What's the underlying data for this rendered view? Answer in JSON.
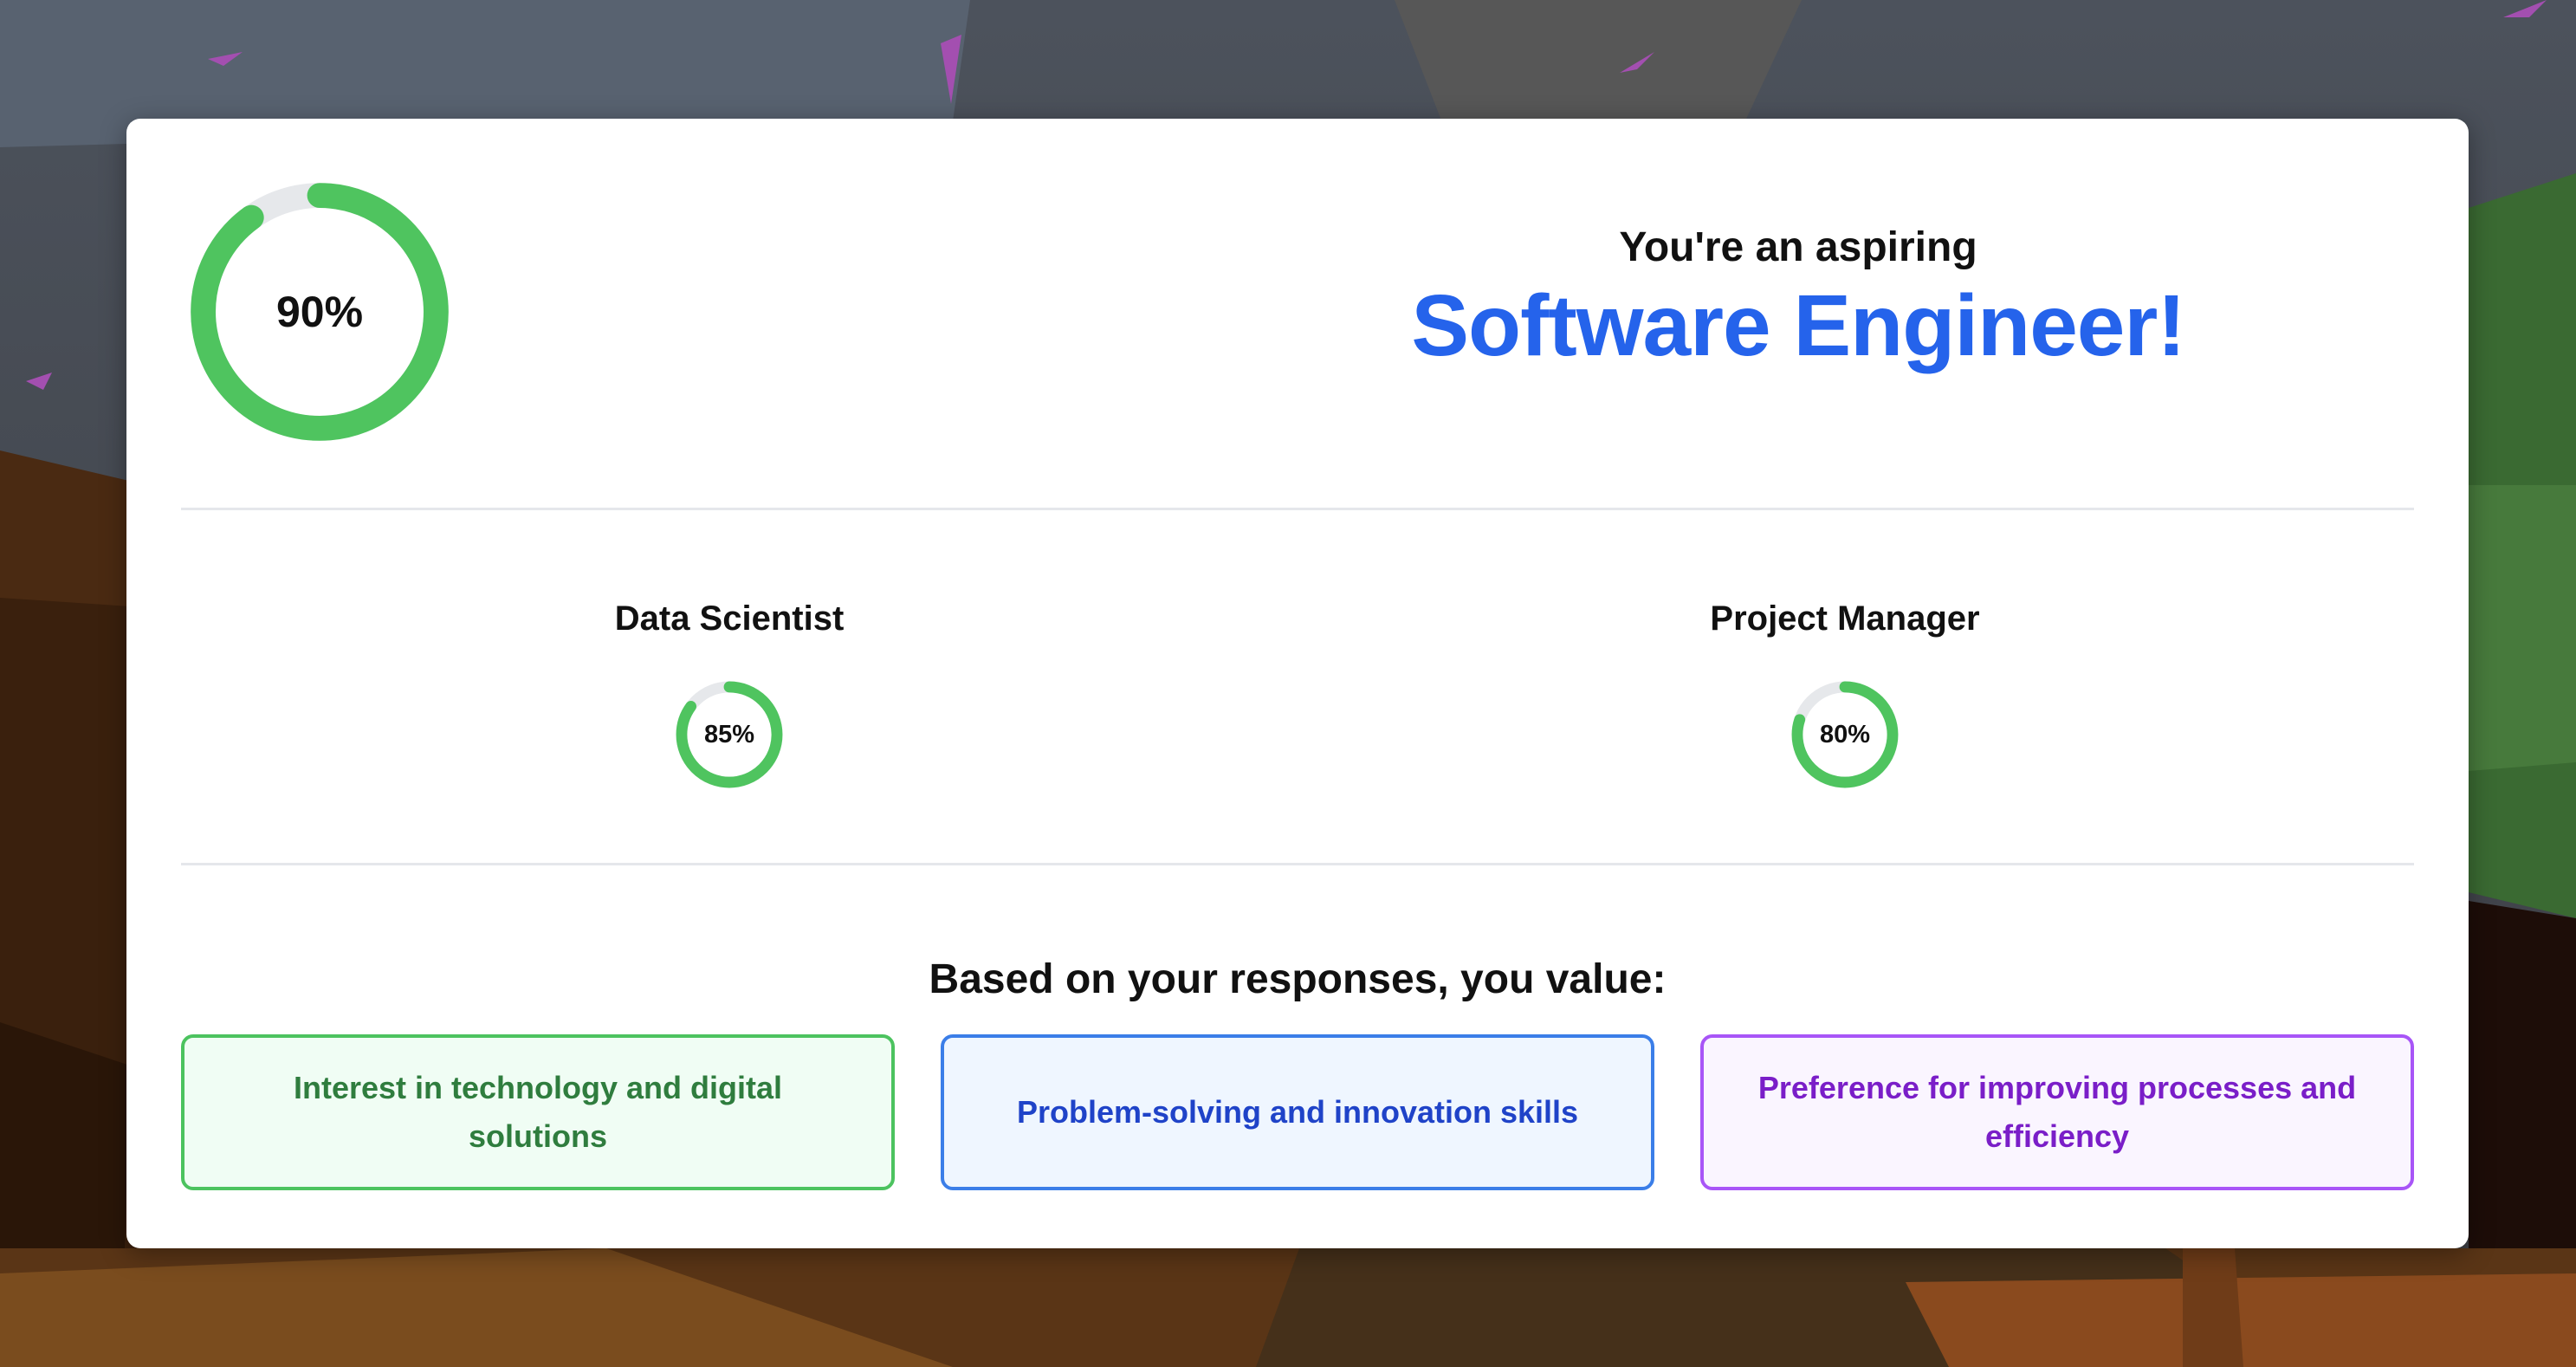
{
  "result": {
    "match_percent": 90,
    "match_label": "90%",
    "subtitle": "You're an aspiring",
    "career": "Software Engineer!"
  },
  "alternatives": [
    {
      "name": "Data Scientist",
      "percent": 85,
      "label": "85%"
    },
    {
      "name": "Project Manager",
      "percent": 80,
      "label": "80%"
    }
  ],
  "values": {
    "title": "Based on your responses, you value:",
    "items": [
      "Interest in technology and digital solutions",
      "Problem-solving and innovation skills",
      "Preference for improving processes and efficiency"
    ]
  },
  "colors": {
    "ring_progress": "#4fc45f",
    "ring_track": "#e6e8eb",
    "accent": "#2563eb",
    "green": "#4cc35f",
    "blue": "#3b7ee8",
    "purple": "#a855f7"
  }
}
